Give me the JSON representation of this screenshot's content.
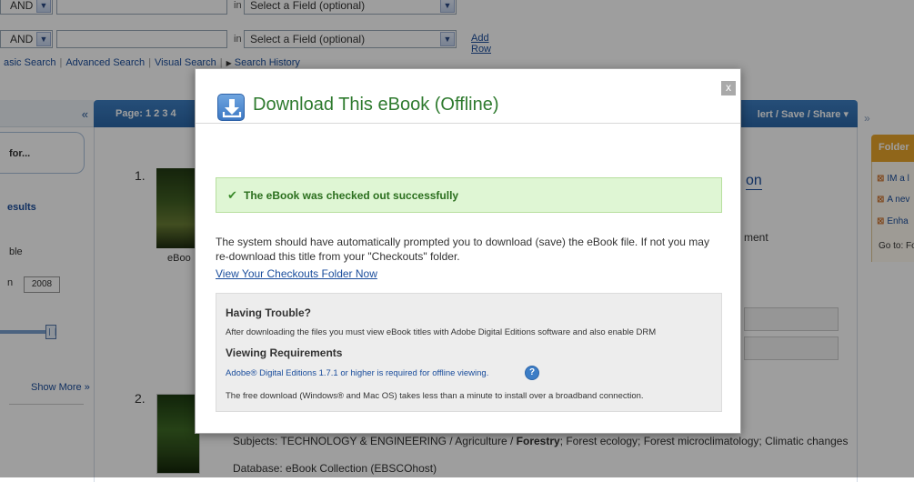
{
  "search": {
    "rows": [
      {
        "bool": "AND",
        "in_label": "in",
        "field": "Select a Field (optional)"
      },
      {
        "bool": "AND",
        "in_label": "in",
        "field": "Select a Field (optional)"
      }
    ],
    "add_row": "Add Row",
    "links": [
      "asic Search",
      "Advanced Search",
      "Visual Search",
      "Search History"
    ]
  },
  "left_panel": {
    "collapse_glyph": "«",
    "refine_label": "for...",
    "results_label": "esults",
    "available_label": "ble",
    "date_prefix": "n",
    "year_value": "2008",
    "show_more": "Show More »"
  },
  "results": {
    "pages_label": "Page: 1 2 3 4",
    "share_label": "lert / Save / Share ▾",
    "items": [
      {
        "number": "1.",
        "format": "eBoo",
        "title_fragment": "on",
        "desc_fragment": "ment"
      },
      {
        "number": "2.",
        "subjects": "Subjects: TECHNOLOGY & ENGINEERING / Agriculture / ",
        "subject_bold": "Forestry",
        "subjects_rest": "; Forest ecology; Forest microclimatology; Climatic changes",
        "database": "Database: eBook Collection (EBSCOhost)"
      }
    ]
  },
  "right_panel": {
    "expand_glyph": "»",
    "folder_label": "Folder",
    "items": [
      "IM a l",
      "A nev",
      "Enha"
    ],
    "goto": "Go to: Fo"
  },
  "modal": {
    "title": "Download This eBook (Offline)",
    "close_glyph": "x",
    "success_message": "The eBook was checked out successfully",
    "body_text": "The system should have automatically prompted you to download (save) the eBook file. If not you may re-download this title from your \"Checkouts\" folder.",
    "view_checkouts_link": "View Your Checkouts Folder Now",
    "trouble": {
      "heading": "Having Trouble?",
      "text": "After downloading the files you must view eBook titles with Adobe Digital Editions software and also enable DRM",
      "req_heading": "Viewing Requirements",
      "req_link": "Adobe® Digital Editions 1.7.1 or higher is required for offline viewing.",
      "free_download": "The free download (Windows® and Mac OS) takes less than a minute to install over a broadband connection."
    }
  },
  "colors": {
    "title_green": "#2e7a2e",
    "success_bg": "#dff6d4",
    "link_blue": "#1a4d9c",
    "results_bar": "#2b67a8",
    "folder_orange": "#e8a52a"
  },
  "icons": {
    "download": "download-icon",
    "close": "close-icon",
    "success": "checkmark-icon",
    "help": "help-icon"
  }
}
